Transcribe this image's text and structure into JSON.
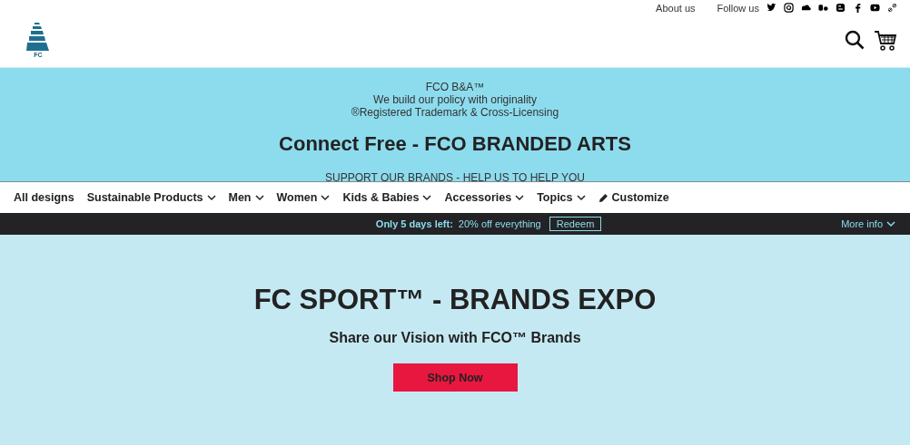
{
  "logo": {
    "text": "FC"
  },
  "top_links": [
    {
      "label": "About us"
    },
    {
      "label": "Follow us"
    }
  ],
  "banner": {
    "lines": [
      "FCO B&A™",
      "We build our policy with originality",
      "®Registered Trademark & Cross-Licensing"
    ],
    "title": "Connect Free - FCO BRANDED ARTS",
    "tagline": "SUPPORT OUR BRANDS - HELP US TO HELP YOU"
  },
  "nav": [
    {
      "label": "All designs",
      "kind": "link"
    },
    {
      "label": "Sustainable Products",
      "kind": "dropdown"
    },
    {
      "label": "Men",
      "kind": "dropdown"
    },
    {
      "label": "Women",
      "kind": "dropdown"
    },
    {
      "label": "Kids & Babies",
      "kind": "dropdown"
    },
    {
      "label": "Accessories",
      "kind": "dropdown"
    },
    {
      "label": "Topics",
      "kind": "dropdown"
    },
    {
      "label": "Customize",
      "kind": "customize"
    }
  ],
  "promo": {
    "highlight": "Only 5 days left:",
    "text": "20% off everything",
    "button": "Redeem",
    "more": "More info"
  },
  "hero": {
    "title": "FC SPORT™ - BRANDS EXPO",
    "subtitle": "Share our Vision with FCO™ Brands",
    "button": "Shop Now"
  }
}
